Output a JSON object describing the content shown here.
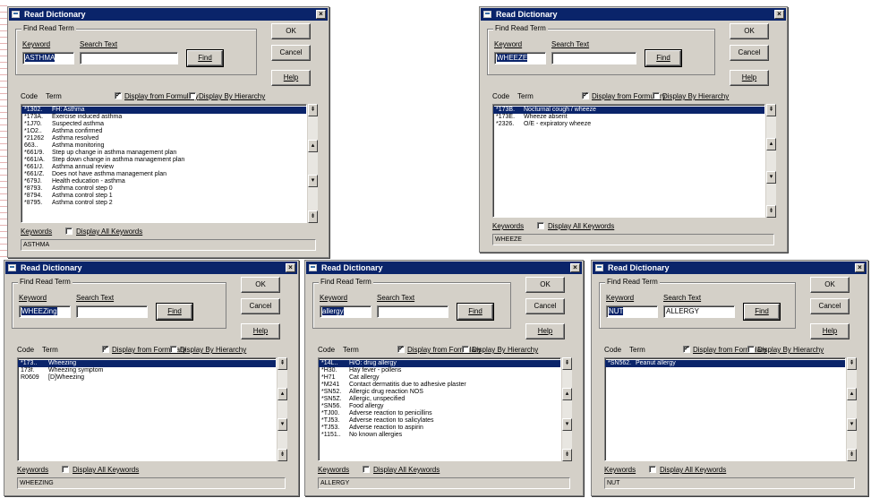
{
  "common": {
    "title": "Read Dictionary",
    "group_label": "Find Read Term",
    "keyword_label": "Keyword",
    "search_label": "Search Text",
    "find_btn": "Find",
    "ok_btn": "OK",
    "cancel_btn": "Cancel",
    "help_btn": "Help",
    "col_code": "Code",
    "col_term": "Term",
    "display_formulary": "Display from Formulary",
    "display_hierarchy": "Display By Hierarchy",
    "keywords_label": "Keywords",
    "display_all_keywords": "Display All Keywords",
    "close_glyph": "×"
  },
  "dialogs": [
    {
      "keyword": "ASTHMA",
      "search_text": "",
      "status": "ASTHMA",
      "formulary_checked": true,
      "hierarchy_checked": false,
      "rows": [
        {
          "code": "*1302.",
          "term": "FH: Asthma",
          "selected": true
        },
        {
          "code": "*173A.",
          "term": "Exercise induced asthma"
        },
        {
          "code": "*1J70.",
          "term": "Suspected asthma"
        },
        {
          "code": "*1O2..",
          "term": "Asthma confirmed"
        },
        {
          "code": "*21262",
          "term": "Asthma resolved"
        },
        {
          "code": " 663..",
          "term": "Asthma monitoring"
        },
        {
          "code": "*661/9.",
          "term": "Step up change in asthma management plan"
        },
        {
          "code": "*661/A.",
          "term": "Step down change in asthma management plan"
        },
        {
          "code": "*661/J.",
          "term": "Asthma annual review"
        },
        {
          "code": "*661/Z.",
          "term": "Does not have asthma management plan"
        },
        {
          "code": "*679J.",
          "term": "Health education - asthma"
        },
        {
          "code": "*8793.",
          "term": "Asthma control step 0"
        },
        {
          "code": "*8794.",
          "term": "Asthma control step 1"
        },
        {
          "code": "*8795.",
          "term": "Asthma control step 2"
        }
      ]
    },
    {
      "keyword": "WHEEZE",
      "search_text": "",
      "status": "WHEEZE",
      "formulary_checked": true,
      "hierarchy_checked": false,
      "rows": [
        {
          "code": "*173B.",
          "term": "Nocturnal cough / wheeze",
          "selected": true
        },
        {
          "code": "*173E.",
          "term": "Wheeze absent"
        },
        {
          "code": "*2326.",
          "term": "O/E - expiratory wheeze"
        }
      ]
    },
    {
      "keyword": "WHEEZing",
      "search_text": "",
      "status": "WHEEZING",
      "formulary_checked": true,
      "hierarchy_checked": false,
      "rows": [
        {
          "code": "*173..",
          "term": "Wheezing",
          "selected": true
        },
        {
          "code": " 173f.",
          "term": "Wheezing symptom"
        },
        {
          "code": " R0609",
          "term": "[D]Wheezing"
        }
      ]
    },
    {
      "keyword": "allergy",
      "search_text": "",
      "status": "ALLERGY",
      "formulary_checked": true,
      "hierarchy_checked": false,
      "rows": [
        {
          "code": "*14L..",
          "term": "H/O: drug allergy",
          "selected": true
        },
        {
          "code": "*H30.",
          "term": "Hay fever - pollens"
        },
        {
          "code": "*H71",
          "term": "Cat allergy"
        },
        {
          "code": "*M241",
          "term": "Contact dermatitis due to adhesive plaster"
        },
        {
          "code": "*SN52.",
          "term": "Allergic drug reaction NOS"
        },
        {
          "code": "*SN5Z.",
          "term": "Allergic, unspecified"
        },
        {
          "code": "*SN56.",
          "term": "Food allergy"
        },
        {
          "code": "*TJ00.",
          "term": "Adverse reaction to penicillins"
        },
        {
          "code": "*TJ53.",
          "term": "Adverse reaction to salicylates"
        },
        {
          "code": "*TJ53.",
          "term": "Adverse reaction to aspirin"
        },
        {
          "code": "*1151..",
          "term": "No known allergies"
        }
      ]
    },
    {
      "keyword": "NUT",
      "search_text": "ALLERGY",
      "status": "NUT",
      "formulary_checked": true,
      "hierarchy_checked": false,
      "rows": [
        {
          "code": "*SN562.",
          "term": "Peanut allergy",
          "selected": true
        }
      ]
    }
  ]
}
